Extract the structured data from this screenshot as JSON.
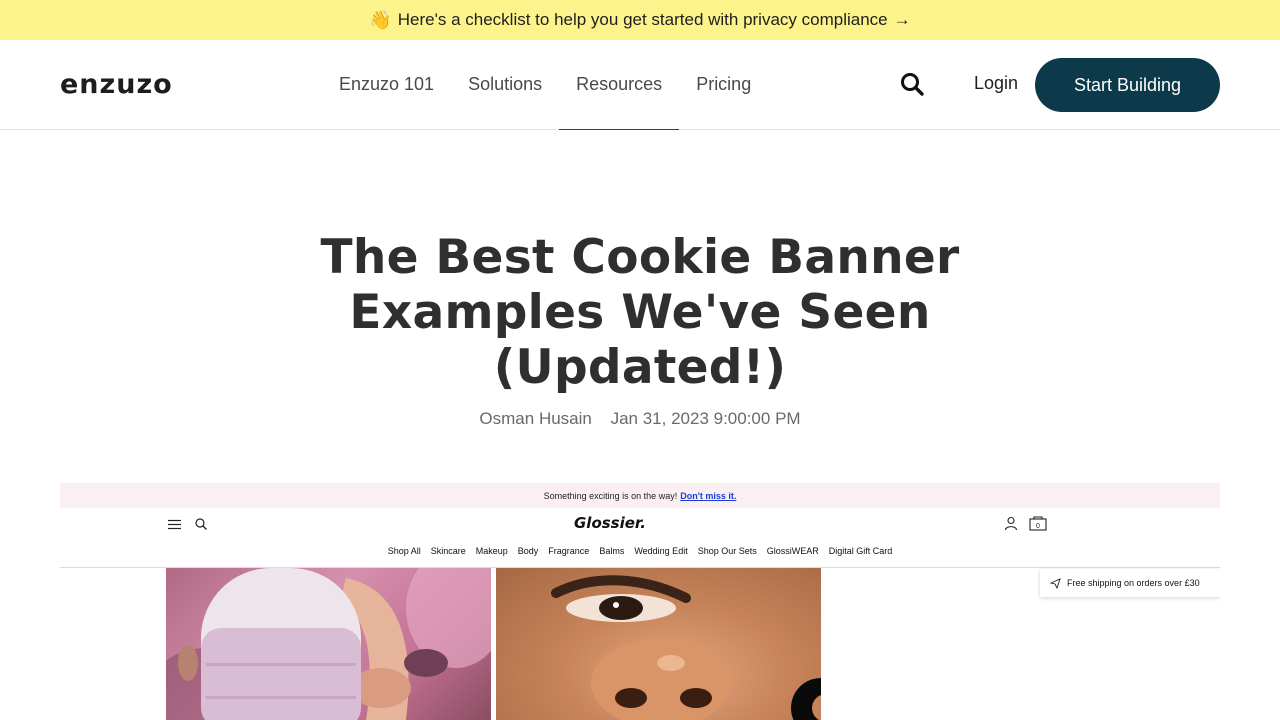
{
  "announcement": {
    "emoji": "👋",
    "text": "Here's a checklist to help you get started with privacy compliance",
    "arrow": "→",
    "bg_color": "#fdf38b"
  },
  "header": {
    "logo": "enzuzo",
    "nav": [
      "Enzuzo 101",
      "Solutions",
      "Resources",
      "Pricing"
    ],
    "active_nav": "Resources",
    "search_icon": "search-icon",
    "login_label": "Login",
    "cta_label": "Start Building",
    "cta_color": "#0d3a4a"
  },
  "article": {
    "title": "The Best Cookie Banner Examples We've Seen (Updated!)",
    "author": "Osman Husain",
    "date": "Jan 31, 2023 9:00:00 PM"
  },
  "screenshot": {
    "promo_text": "Something exciting is on the way!",
    "promo_link": "Don't miss it.",
    "brand": "Glossier.",
    "nav": [
      "Shop All",
      "Skincare",
      "Makeup",
      "Body",
      "Fragrance",
      "Balms",
      "Wedding Edit",
      "Shop Our Sets",
      "GlossiWEAR",
      "Digital Gift Card"
    ],
    "shipping_text": "Free shipping on orders over £30",
    "bag_count": "0"
  }
}
